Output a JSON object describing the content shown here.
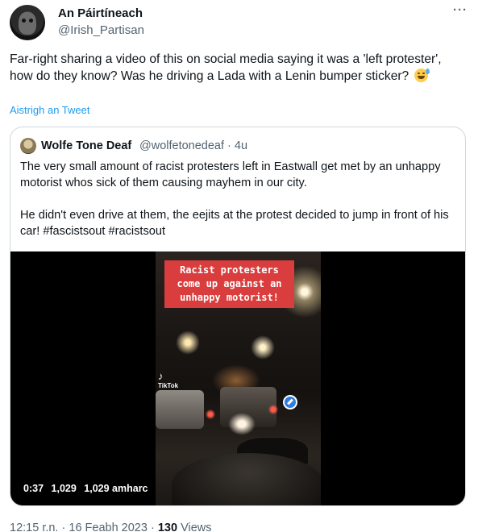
{
  "author": {
    "display_name": "An Páirtíneach",
    "handle": "@Irish_Partisan"
  },
  "more_icon": "more-horizontal-icon",
  "tweet": {
    "text": "Far-right sharing a video of this on social media saying it was a 'left protester', how do they know? Was he driving a Lada with a Lenin bumper sticker?",
    "emoji": "sweat-smile-emoji",
    "translate_label": "Aistrigh an Tweet"
  },
  "quote": {
    "display_name": "Wolfe Tone Deaf",
    "handle": "@wolfetonedeaf",
    "separator": "·",
    "time": "4u",
    "paragraphs": [
      "The very small amount of racist protesters left in Eastwall get met by an unhappy motorist whos sick of them causing mayhem in our city.",
      "He didn't even drive at them, the eejits at the protest decided to jump in front of his car! #fascistsout #racistsout"
    ],
    "video": {
      "banner_line1": "Racist protesters",
      "banner_line2": "come up against an",
      "banner_line3": "unhappy motorist!",
      "watermark": "TikTok",
      "duration": "0:37",
      "views": "1,029",
      "views_label": "1,029 amharc"
    }
  },
  "footer": {
    "time": "12:15 r.n.",
    "separator": "·",
    "date": "16 Feabh 2023",
    "views_count": "130",
    "views_label": "Views"
  },
  "colors": {
    "text": "#0f1419",
    "secondary": "#536471",
    "link": "#1d9bf0",
    "banner": "#d93d3d"
  }
}
